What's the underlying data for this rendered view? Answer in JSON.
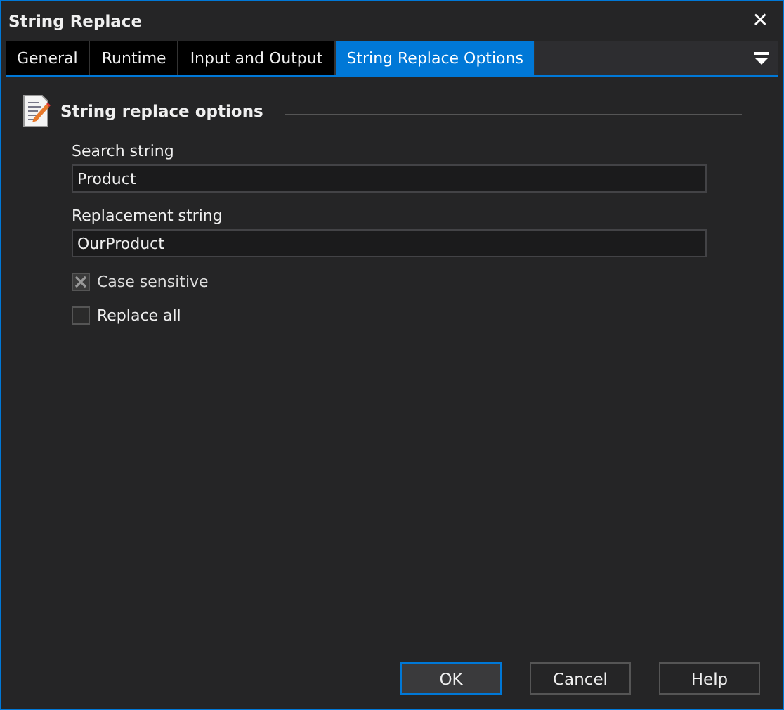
{
  "window": {
    "title": "String Replace",
    "close": "✕"
  },
  "tabs": [
    {
      "label": "General",
      "selected": false
    },
    {
      "label": "Runtime",
      "selected": false
    },
    {
      "label": "Input and Output",
      "selected": false
    },
    {
      "label": "String Replace Options",
      "selected": true
    }
  ],
  "section": {
    "title": "String replace options"
  },
  "fields": [
    {
      "label": "Search string",
      "value": "Product"
    },
    {
      "label": "Replacement string",
      "value": "OurProduct"
    }
  ],
  "checkboxes": [
    {
      "label": "Case sensitive",
      "checked": true,
      "disabled": true
    },
    {
      "label": "Replace all",
      "checked": false,
      "disabled": false
    }
  ],
  "buttons": [
    {
      "label": "OK",
      "selected": true
    },
    {
      "label": "Cancel",
      "selected": false
    },
    {
      "label": "Help",
      "selected": false
    }
  ]
}
